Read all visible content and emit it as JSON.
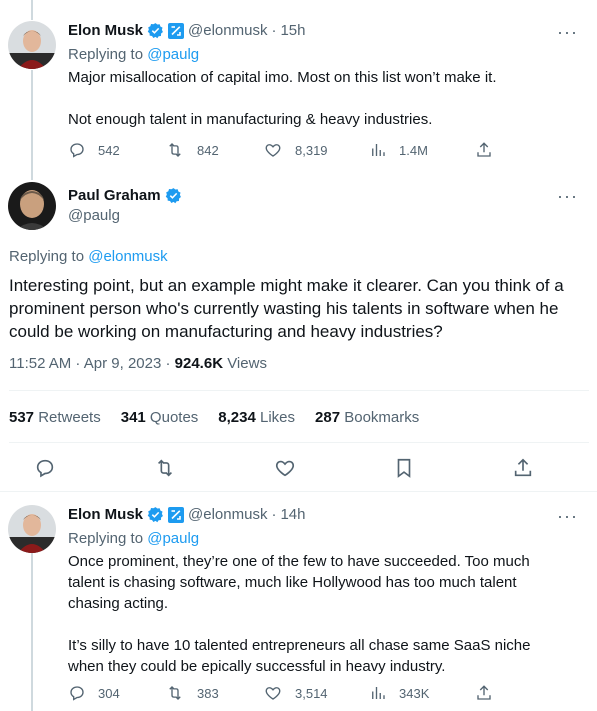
{
  "reply1": {
    "author_name": "Elon Musk",
    "author_handle": "@elonmusk",
    "time_ago": "15h",
    "replying_label": "Replying to",
    "replying_handle": "@paulg",
    "text": "Major misallocation of capital imo. Most on this list won’t make it.\n\nNot enough talent in manufacturing & heavy industries.",
    "replies": "542",
    "retweets": "842",
    "likes": "8,319",
    "views": "1.4M"
  },
  "main_tweet": {
    "author_name": "Paul Graham",
    "author_handle": "@paulg",
    "replying_label": "Replying to",
    "replying_handle": "@elonmusk",
    "text": "Interesting point, but an example might make it clearer. Can you think of a prominent person who's currently wasting his talents in software when he could be working on manufacturing and heavy industries?",
    "timestamp": "11:52 AM · Apr 9, 2023 · ",
    "views_count": "924.6K",
    "views_label": " Views",
    "retweets_count": "537",
    "retweets_label": " Retweets",
    "quotes_count": "341",
    "quotes_label": " Quotes",
    "likes_count": "8,234",
    "likes_label": " Likes",
    "bookmarks_count": "287",
    "bookmarks_label": " Bookmarks"
  },
  "reply2": {
    "author_name": "Elon Musk",
    "author_handle": "@elonmusk",
    "time_ago": "14h",
    "replying_label": "Replying to",
    "replying_handle": "@paulg",
    "text": "Once prominent, they’re one of the few to have succeeded. Too much talent is chasing software, much like Hollywood has too much talent chasing acting.\n\nIt’s silly to have 10 talented entrepreneurs all chase same SaaS niche when they could be epically successful in heavy industry.",
    "replies": "304",
    "retweets": "383",
    "likes": "3,514",
    "views": "343K"
  },
  "colors": {
    "verified_blue": "#1d9bf0",
    "link_blue": "#1d9bf0",
    "muted_gray": "#536471",
    "thread_line": "#cfd9de"
  },
  "icons": {
    "more": "more-horizontal-icon",
    "reply": "reply-icon",
    "retweet": "retweet-icon",
    "like": "heart-icon",
    "views": "analytics-icon",
    "share": "share-icon",
    "bookmark": "bookmark-icon",
    "verified": "verified-badge-icon",
    "affiliate": "x-affiliation-icon"
  }
}
